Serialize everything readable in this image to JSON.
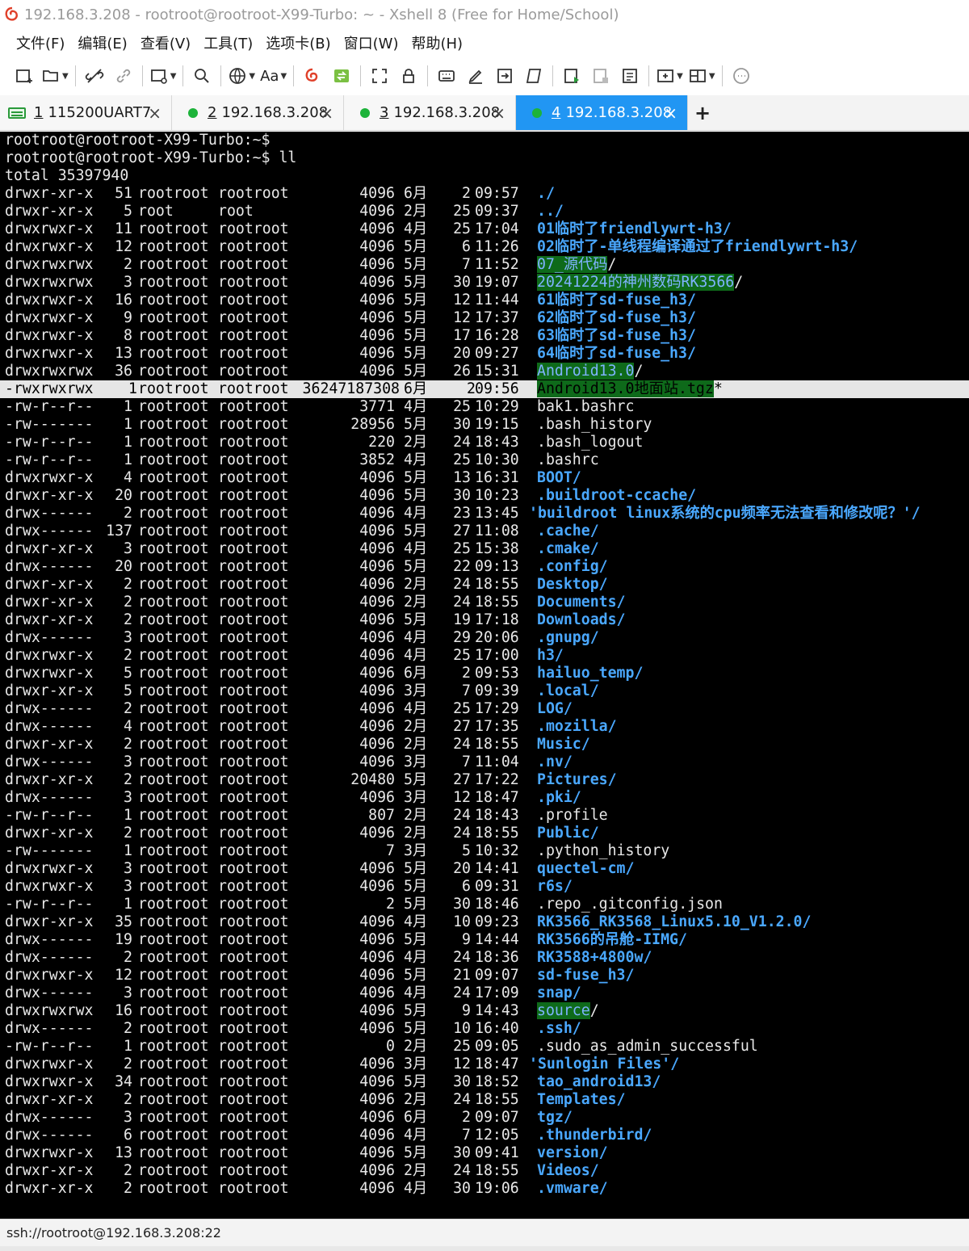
{
  "window": {
    "title": "192.168.3.208 - rootroot@rootroot-X99-Turbo: ~ - Xshell 8 (Free for Home/School)"
  },
  "menu": [
    "文件(F)",
    "编辑(E)",
    "查看(V)",
    "工具(T)",
    "选项卡(B)",
    "窗口(W)",
    "帮助(H)"
  ],
  "toolbar": {
    "font_label": "Aa"
  },
  "tabs": [
    {
      "num": "1",
      "label": "115200UART7",
      "status": "serial"
    },
    {
      "num": "2",
      "label": "192.168.3.208",
      "status": "connected"
    },
    {
      "num": "3",
      "label": "192.168.3.208",
      "status": "connected"
    },
    {
      "num": "4",
      "label": "192.168.3.208",
      "status": "connected",
      "active": true
    }
  ],
  "terminal": {
    "prompt1": "rootroot@rootroot-X99-Turbo:~$",
    "prompt2": "rootroot@rootroot-X99-Turbo:~$ ll",
    "total": "total 35397940",
    "entries": [
      {
        "perm": "drwxr-xr-x",
        "links": "51",
        "user": "rootroot",
        "group": "rootroot",
        "size": "4096",
        "month": "6月",
        "day": "2",
        "time": "09:57",
        "name": "./",
        "style": "blue"
      },
      {
        "perm": "drwxr-xr-x",
        "links": "5",
        "user": "root",
        "group": "root",
        "size": "4096",
        "month": "2月",
        "day": "25",
        "time": "09:37",
        "name": "../",
        "style": "blue"
      },
      {
        "perm": "drwxrwxr-x",
        "links": "11",
        "user": "rootroot",
        "group": "rootroot",
        "size": "4096",
        "month": "4月",
        "day": "25",
        "time": "17:04",
        "name": "01临时了friendlywrt-h3/",
        "style": "blue"
      },
      {
        "perm": "drwxrwxr-x",
        "links": "12",
        "user": "rootroot",
        "group": "rootroot",
        "size": "4096",
        "month": "5月",
        "day": "6",
        "time": "11:26",
        "name": "02临时了-单线程编译通过了friendlywrt-h3/",
        "style": "blue"
      },
      {
        "perm": "drwxrwxrwx",
        "links": "2",
        "user": "rootroot",
        "group": "rootroot",
        "size": "4096",
        "month": "5月",
        "day": "7",
        "time": "11:52",
        "name": "07_源代码",
        "suffix": "/",
        "style": "green-bg"
      },
      {
        "perm": "drwxrwxrwx",
        "links": "3",
        "user": "rootroot",
        "group": "rootroot",
        "size": "4096",
        "month": "5月",
        "day": "30",
        "time": "19:07",
        "name": "20241224的神州数码RK3566",
        "suffix": "/",
        "style": "green-bg"
      },
      {
        "perm": "drwxrwxr-x",
        "links": "16",
        "user": "rootroot",
        "group": "rootroot",
        "size": "4096",
        "month": "5月",
        "day": "12",
        "time": "11:44",
        "name": "61临时了sd-fuse_h3/",
        "style": "blue"
      },
      {
        "perm": "drwxrwxr-x",
        "links": "9",
        "user": "rootroot",
        "group": "rootroot",
        "size": "4096",
        "month": "5月",
        "day": "12",
        "time": "17:37",
        "name": "62临时了sd-fuse_h3/",
        "style": "blue"
      },
      {
        "perm": "drwxrwxr-x",
        "links": "8",
        "user": "rootroot",
        "group": "rootroot",
        "size": "4096",
        "month": "5月",
        "day": "17",
        "time": "16:28",
        "name": "63临时了sd-fuse_h3/",
        "style": "blue"
      },
      {
        "perm": "drwxrwxr-x",
        "links": "13",
        "user": "rootroot",
        "group": "rootroot",
        "size": "4096",
        "month": "5月",
        "day": "20",
        "time": "09:27",
        "name": "64临时了sd-fuse_h3/",
        "style": "blue"
      },
      {
        "perm": "drwxrwxrwx",
        "links": "36",
        "user": "rootroot",
        "group": "rootroot",
        "size": "4096",
        "month": "5月",
        "day": "26",
        "time": "15:31",
        "name": "Android13.0",
        "suffix": "/",
        "style": "green-bg"
      },
      {
        "perm": "-rwxrwxrwx",
        "links": "1",
        "user": "rootroot",
        "group": "rootroot",
        "size": "36247187308",
        "month": "6月",
        "day": "2",
        "time": "09:56",
        "name": "Android13.0地面站.tgz",
        "suffix": "*",
        "style": "green-bg",
        "highlight": true
      },
      {
        "perm": "-rw-r--r--",
        "links": "1",
        "user": "rootroot",
        "group": "rootroot",
        "size": "3771",
        "month": "4月",
        "day": "25",
        "time": "10:29",
        "name": "bak1.bashrc",
        "style": "plain"
      },
      {
        "perm": "-rw-------",
        "links": "1",
        "user": "rootroot",
        "group": "rootroot",
        "size": "28956",
        "month": "5月",
        "day": "30",
        "time": "19:15",
        "name": ".bash_history",
        "style": "plain"
      },
      {
        "perm": "-rw-r--r--",
        "links": "1",
        "user": "rootroot",
        "group": "rootroot",
        "size": "220",
        "month": "2月",
        "day": "24",
        "time": "18:43",
        "name": ".bash_logout",
        "style": "plain"
      },
      {
        "perm": "-rw-r--r--",
        "links": "1",
        "user": "rootroot",
        "group": "rootroot",
        "size": "3852",
        "month": "4月",
        "day": "25",
        "time": "10:30",
        "name": ".bashrc",
        "style": "plain"
      },
      {
        "perm": "drwxrwxr-x",
        "links": "4",
        "user": "rootroot",
        "group": "rootroot",
        "size": "4096",
        "month": "5月",
        "day": "13",
        "time": "16:31",
        "name": "BOOT/",
        "style": "blue"
      },
      {
        "perm": "drwxr-xr-x",
        "links": "20",
        "user": "rootroot",
        "group": "rootroot",
        "size": "4096",
        "month": "5月",
        "day": "30",
        "time": "10:23",
        "name": ".buildroot-ccache/",
        "style": "blue"
      },
      {
        "perm": "drwx------",
        "links": "2",
        "user": "rootroot",
        "group": "rootroot",
        "size": "4096",
        "month": "4月",
        "day": "23",
        "time": "13:45",
        "name": "'buildroot linux系统的cpu频率无法查看和修改呢？'/",
        "style": "blue",
        "offset": -10
      },
      {
        "perm": "drwx------",
        "links": "137",
        "user": "rootroot",
        "group": "rootroot",
        "size": "4096",
        "month": "5月",
        "day": "27",
        "time": "11:08",
        "name": ".cache/",
        "style": "blue"
      },
      {
        "perm": "drwxr-xr-x",
        "links": "3",
        "user": "rootroot",
        "group": "rootroot",
        "size": "4096",
        "month": "4月",
        "day": "25",
        "time": "15:38",
        "name": ".cmake/",
        "style": "blue"
      },
      {
        "perm": "drwx------",
        "links": "20",
        "user": "rootroot",
        "group": "rootroot",
        "size": "4096",
        "month": "5月",
        "day": "22",
        "time": "09:13",
        "name": ".config/",
        "style": "blue"
      },
      {
        "perm": "drwxr-xr-x",
        "links": "2",
        "user": "rootroot",
        "group": "rootroot",
        "size": "4096",
        "month": "2月",
        "day": "24",
        "time": "18:55",
        "name": "Desktop/",
        "style": "blue"
      },
      {
        "perm": "drwxr-xr-x",
        "links": "2",
        "user": "rootroot",
        "group": "rootroot",
        "size": "4096",
        "month": "2月",
        "day": "24",
        "time": "18:55",
        "name": "Documents/",
        "style": "blue"
      },
      {
        "perm": "drwxr-xr-x",
        "links": "2",
        "user": "rootroot",
        "group": "rootroot",
        "size": "4096",
        "month": "5月",
        "day": "19",
        "time": "17:18",
        "name": "Downloads/",
        "style": "blue"
      },
      {
        "perm": "drwx------",
        "links": "3",
        "user": "rootroot",
        "group": "rootroot",
        "size": "4096",
        "month": "4月",
        "day": "29",
        "time": "20:06",
        "name": ".gnupg/",
        "style": "blue"
      },
      {
        "perm": "drwxrwxr-x",
        "links": "2",
        "user": "rootroot",
        "group": "rootroot",
        "size": "4096",
        "month": "4月",
        "day": "25",
        "time": "17:00",
        "name": "h3/",
        "style": "blue"
      },
      {
        "perm": "drwxrwxr-x",
        "links": "5",
        "user": "rootroot",
        "group": "rootroot",
        "size": "4096",
        "month": "6月",
        "day": "2",
        "time": "09:53",
        "name": "hailuo_temp/",
        "style": "blue"
      },
      {
        "perm": "drwxr-xr-x",
        "links": "5",
        "user": "rootroot",
        "group": "rootroot",
        "size": "4096",
        "month": "3月",
        "day": "7",
        "time": "09:39",
        "name": ".local/",
        "style": "blue"
      },
      {
        "perm": "drwx------",
        "links": "2",
        "user": "rootroot",
        "group": "rootroot",
        "size": "4096",
        "month": "4月",
        "day": "25",
        "time": "17:29",
        "name": "LOG/",
        "style": "blue"
      },
      {
        "perm": "drwx------",
        "links": "4",
        "user": "rootroot",
        "group": "rootroot",
        "size": "4096",
        "month": "2月",
        "day": "27",
        "time": "17:35",
        "name": ".mozilla/",
        "style": "blue"
      },
      {
        "perm": "drwxr-xr-x",
        "links": "2",
        "user": "rootroot",
        "group": "rootroot",
        "size": "4096",
        "month": "2月",
        "day": "24",
        "time": "18:55",
        "name": "Music/",
        "style": "blue"
      },
      {
        "perm": "drwx------",
        "links": "3",
        "user": "rootroot",
        "group": "rootroot",
        "size": "4096",
        "month": "3月",
        "day": "7",
        "time": "11:04",
        "name": ".nv/",
        "style": "blue"
      },
      {
        "perm": "drwxr-xr-x",
        "links": "2",
        "user": "rootroot",
        "group": "rootroot",
        "size": "20480",
        "month": "5月",
        "day": "27",
        "time": "17:22",
        "name": "Pictures/",
        "style": "blue"
      },
      {
        "perm": "drwx------",
        "links": "3",
        "user": "rootroot",
        "group": "rootroot",
        "size": "4096",
        "month": "3月",
        "day": "12",
        "time": "18:47",
        "name": ".pki/",
        "style": "blue"
      },
      {
        "perm": "-rw-r--r--",
        "links": "1",
        "user": "rootroot",
        "group": "rootroot",
        "size": "807",
        "month": "2月",
        "day": "24",
        "time": "18:43",
        "name": ".profile",
        "style": "plain"
      },
      {
        "perm": "drwxr-xr-x",
        "links": "2",
        "user": "rootroot",
        "group": "rootroot",
        "size": "4096",
        "month": "2月",
        "day": "24",
        "time": "18:55",
        "name": "Public/",
        "style": "blue"
      },
      {
        "perm": "-rw-------",
        "links": "1",
        "user": "rootroot",
        "group": "rootroot",
        "size": "7",
        "month": "3月",
        "day": "5",
        "time": "10:32",
        "name": ".python_history",
        "style": "plain"
      },
      {
        "perm": "drwxrwxr-x",
        "links": "3",
        "user": "rootroot",
        "group": "rootroot",
        "size": "4096",
        "month": "5月",
        "day": "20",
        "time": "14:41",
        "name": "quectel-cm/",
        "style": "blue"
      },
      {
        "perm": "drwxrwxr-x",
        "links": "3",
        "user": "rootroot",
        "group": "rootroot",
        "size": "4096",
        "month": "5月",
        "day": "6",
        "time": "09:31",
        "name": "r6s/",
        "style": "blue"
      },
      {
        "perm": "-rw-r--r--",
        "links": "1",
        "user": "rootroot",
        "group": "rootroot",
        "size": "2",
        "month": "5月",
        "day": "30",
        "time": "18:46",
        "name": ".repo_.gitconfig.json",
        "style": "plain"
      },
      {
        "perm": "drwxr-xr-x",
        "links": "35",
        "user": "rootroot",
        "group": "rootroot",
        "size": "4096",
        "month": "4月",
        "day": "10",
        "time": "09:23",
        "name": "RK3566_RK3568_Linux5.10_V1.2.0/",
        "style": "blue"
      },
      {
        "perm": "drwx------",
        "links": "19",
        "user": "rootroot",
        "group": "rootroot",
        "size": "4096",
        "month": "5月",
        "day": "9",
        "time": "14:44",
        "name": "RK3566的吊舱-IIMG/",
        "style": "blue"
      },
      {
        "perm": "drwx------",
        "links": "2",
        "user": "rootroot",
        "group": "rootroot",
        "size": "4096",
        "month": "4月",
        "day": "24",
        "time": "18:36",
        "name": "RK3588+4800w/",
        "style": "blue"
      },
      {
        "perm": "drwxrwxr-x",
        "links": "12",
        "user": "rootroot",
        "group": "rootroot",
        "size": "4096",
        "month": "5月",
        "day": "21",
        "time": "09:07",
        "name": "sd-fuse_h3/",
        "style": "blue"
      },
      {
        "perm": "drwx------",
        "links": "3",
        "user": "rootroot",
        "group": "rootroot",
        "size": "4096",
        "month": "4月",
        "day": "24",
        "time": "17:09",
        "name": "snap/",
        "style": "blue"
      },
      {
        "perm": "drwxrwxrwx",
        "links": "16",
        "user": "rootroot",
        "group": "rootroot",
        "size": "4096",
        "month": "5月",
        "day": "9",
        "time": "14:43",
        "name": "source",
        "suffix": "/",
        "style": "green-bg"
      },
      {
        "perm": "drwx------",
        "links": "2",
        "user": "rootroot",
        "group": "rootroot",
        "size": "4096",
        "month": "5月",
        "day": "10",
        "time": "16:40",
        "name": ".ssh/",
        "style": "blue"
      },
      {
        "perm": "-rw-r--r--",
        "links": "1",
        "user": "rootroot",
        "group": "rootroot",
        "size": "0",
        "month": "2月",
        "day": "25",
        "time": "09:05",
        "name": ".sudo_as_admin_successful",
        "style": "plain"
      },
      {
        "perm": "drwxrwxr-x",
        "links": "2",
        "user": "rootroot",
        "group": "rootroot",
        "size": "4096",
        "month": "3月",
        "day": "12",
        "time": "18:47",
        "name": "'Sunlogin Files'/",
        "style": "blue",
        "offset": -10
      },
      {
        "perm": "drwxrwxr-x",
        "links": "34",
        "user": "rootroot",
        "group": "rootroot",
        "size": "4096",
        "month": "5月",
        "day": "30",
        "time": "18:52",
        "name": "tao_android13/",
        "style": "blue"
      },
      {
        "perm": "drwxr-xr-x",
        "links": "2",
        "user": "rootroot",
        "group": "rootroot",
        "size": "4096",
        "month": "2月",
        "day": "24",
        "time": "18:55",
        "name": "Templates/",
        "style": "blue"
      },
      {
        "perm": "drwx------",
        "links": "3",
        "user": "rootroot",
        "group": "rootroot",
        "size": "4096",
        "month": "6月",
        "day": "2",
        "time": "09:07",
        "name": "tgz/",
        "style": "blue"
      },
      {
        "perm": "drwx------",
        "links": "6",
        "user": "rootroot",
        "group": "rootroot",
        "size": "4096",
        "month": "4月",
        "day": "7",
        "time": "12:05",
        "name": ".thunderbird/",
        "style": "blue"
      },
      {
        "perm": "drwxrwxr-x",
        "links": "13",
        "user": "rootroot",
        "group": "rootroot",
        "size": "4096",
        "month": "5月",
        "day": "30",
        "time": "09:41",
        "name": "version/",
        "style": "blue"
      },
      {
        "perm": "drwxr-xr-x",
        "links": "2",
        "user": "rootroot",
        "group": "rootroot",
        "size": "4096",
        "month": "2月",
        "day": "24",
        "time": "18:55",
        "name": "Videos/",
        "style": "blue"
      },
      {
        "perm": "drwxr-xr-x",
        "links": "2",
        "user": "rootroot",
        "group": "rootroot",
        "size": "4096",
        "month": "4月",
        "day": "30",
        "time": "19:06",
        "name": ".vmware/",
        "style": "blue"
      }
    ]
  },
  "status": {
    "connection": "ssh://rootroot@192.168.3.208:22"
  },
  "colors": {
    "terminal_bg": "#000000",
    "dir_blue": "#4aa8ff",
    "sticky_green_bg": "#0e6a1a",
    "active_tab": "#2196f3",
    "connected_dot": "#1db33a"
  }
}
